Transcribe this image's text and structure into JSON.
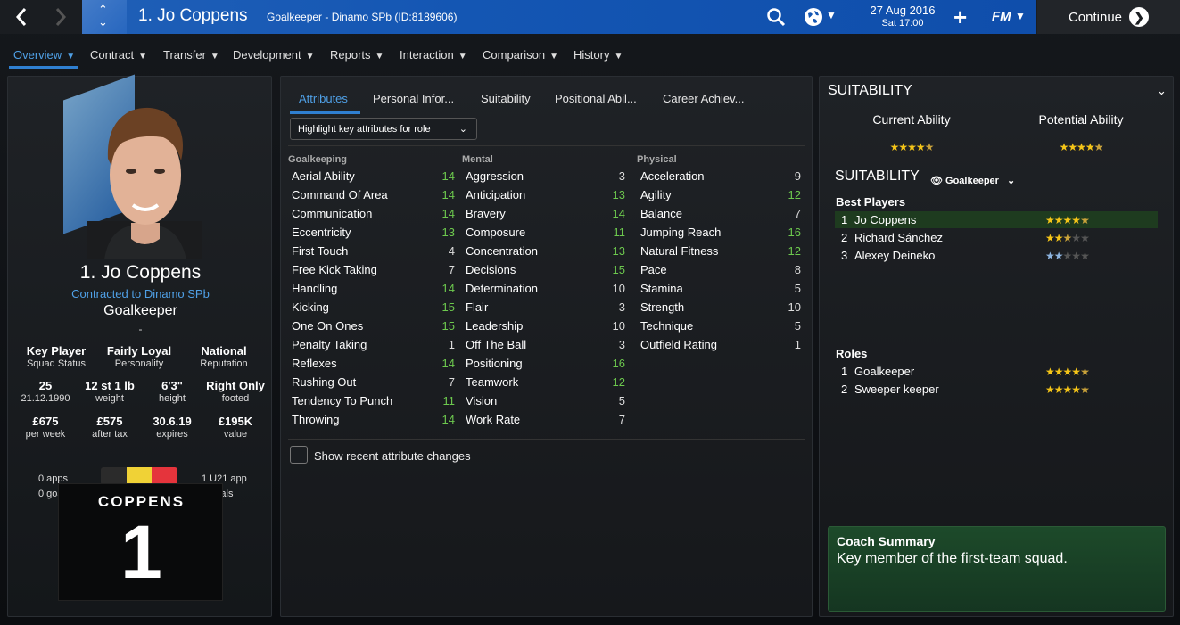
{
  "header": {
    "back_icon": "chevron-left-icon",
    "forward_icon": "chevron-right-icon",
    "player_title": "1. Jo Coppens",
    "player_subtitle": "Goalkeeper - Dinamo SPb (ID:8189606)",
    "date_line1": "27 Aug 2016",
    "date_line2": "Sat 17:00",
    "fm_label": "FM",
    "continue_label": "Continue",
    "brand_color": "#1456b3"
  },
  "menu": {
    "items": [
      "Overview",
      "Contract",
      "Transfer",
      "Development",
      "Reports",
      "Interaction",
      "Comparison",
      "History"
    ]
  },
  "profile": {
    "name": "1. Jo Coppens",
    "contract": "Contracted to Dinamo SPb",
    "position": "Goalkeeper",
    "dash": "-",
    "stats": [
      {
        "value": "Key Player",
        "label": "Squad Status"
      },
      {
        "value": "Fairly Loyal",
        "label": "Personality"
      },
      {
        "value": "National",
        "label": "Reputation"
      },
      {
        "value": "25",
        "label": "21.12.1990"
      },
      {
        "value": "12 st 1 lb",
        "label": "weight"
      },
      {
        "value": "6'3\"",
        "label": "height"
      },
      {
        "value": "Right Only",
        "label": "footed"
      },
      {
        "value": "£675",
        "label": "per week"
      },
      {
        "value": "£575",
        "label": "after tax"
      },
      {
        "value": "30.6.19",
        "label": "expires"
      },
      {
        "value": "£195K",
        "label": "value"
      }
    ],
    "apps_left_1": "0 apps",
    "apps_left_2": "0 goals",
    "apps_right_1": "1 U21 app",
    "apps_right_2": "1 goals",
    "shirt_name": "COPPENS",
    "shirt_number": "1",
    "flag_colors": [
      "#2b2b2b",
      "#f0d236",
      "#e5343c"
    ]
  },
  "tabs": [
    "Attributes",
    "Personal Infor...",
    "Suitability",
    "Positional Abil...",
    "Career Achiev..."
  ],
  "highlight_dropdown": "Highlight key attributes for role",
  "attributes": {
    "goalkeeping": {
      "header": "Goalkeeping",
      "items": [
        {
          "name": "Aerial Ability",
          "value": "14",
          "green": true
        },
        {
          "name": "Command Of Area",
          "value": "14",
          "green": true
        },
        {
          "name": "Communication",
          "value": "14",
          "green": true
        },
        {
          "name": "Eccentricity",
          "value": "13",
          "green": true
        },
        {
          "name": "First Touch",
          "value": "4",
          "green": false
        },
        {
          "name": "Free Kick Taking",
          "value": "7",
          "green": false
        },
        {
          "name": "Handling",
          "value": "14",
          "green": true
        },
        {
          "name": "Kicking",
          "value": "15",
          "green": true
        },
        {
          "name": "One On Ones",
          "value": "15",
          "green": true
        },
        {
          "name": "Penalty Taking",
          "value": "1",
          "green": false
        },
        {
          "name": "Reflexes",
          "value": "14",
          "green": true
        },
        {
          "name": "Rushing Out",
          "value": "7",
          "green": false
        },
        {
          "name": "Tendency To Punch",
          "value": "11",
          "green": true
        },
        {
          "name": "Throwing",
          "value": "14",
          "green": true
        }
      ]
    },
    "mental": {
      "header": "Mental",
      "items": [
        {
          "name": "Aggression",
          "value": "3",
          "green": false
        },
        {
          "name": "Anticipation",
          "value": "13",
          "green": true
        },
        {
          "name": "Bravery",
          "value": "14",
          "green": true
        },
        {
          "name": "Composure",
          "value": "11",
          "green": true
        },
        {
          "name": "Concentration",
          "value": "13",
          "green": true
        },
        {
          "name": "Decisions",
          "value": "15",
          "green": true
        },
        {
          "name": "Determination",
          "value": "10",
          "green": false
        },
        {
          "name": "Flair",
          "value": "3",
          "green": false
        },
        {
          "name": "Leadership",
          "value": "10",
          "green": false
        },
        {
          "name": "Off The Ball",
          "value": "3",
          "green": false
        },
        {
          "name": "Positioning",
          "value": "16",
          "green": true
        },
        {
          "name": "Teamwork",
          "value": "12",
          "green": true
        },
        {
          "name": "Vision",
          "value": "5",
          "green": false
        },
        {
          "name": "Work Rate",
          "value": "7",
          "green": false
        }
      ]
    },
    "physical": {
      "header": "Physical",
      "items": [
        {
          "name": "Acceleration",
          "value": "9",
          "green": false
        },
        {
          "name": "Agility",
          "value": "12",
          "green": true
        },
        {
          "name": "Balance",
          "value": "7",
          "green": false
        },
        {
          "name": "Jumping Reach",
          "value": "16",
          "green": true
        },
        {
          "name": "Natural Fitness",
          "value": "12",
          "green": true
        },
        {
          "name": "Pace",
          "value": "8",
          "green": false
        },
        {
          "name": "Stamina",
          "value": "5",
          "green": false
        },
        {
          "name": "Strength",
          "value": "10",
          "green": false
        },
        {
          "name": "Technique",
          "value": "5",
          "green": false
        },
        {
          "name": "Outfield Rating",
          "value": "1",
          "green": false
        }
      ]
    }
  },
  "recent_changes_label": "Show recent attribute changes",
  "suitability": {
    "title": "SUITABILITY",
    "current_ability_label": "Current Ability",
    "potential_ability_label": "Potential Ability",
    "current_ability_stars": 4.5,
    "potential_ability_stars": 4.5,
    "subtitle": "SUITABILITY",
    "role_dropdown": "Goalkeeper",
    "best_players_title": "Best Players",
    "best_players": [
      {
        "rank": "1",
        "name": "Jo Coppens",
        "stars": 4.5
      },
      {
        "rank": "2",
        "name": "Richard Sánchez",
        "stars": 2.5
      },
      {
        "rank": "3",
        "name": "Alexey Deineko",
        "stars": 1.5
      }
    ],
    "roles_title": "Roles",
    "roles": [
      {
        "rank": "1",
        "name": "Goalkeeper",
        "stars": 4.5
      },
      {
        "rank": "2",
        "name": "Sweeper keeper",
        "stars": 4.5
      }
    ]
  },
  "coach": {
    "title": "Coach Summary",
    "text": "Key member of the first-team squad."
  }
}
